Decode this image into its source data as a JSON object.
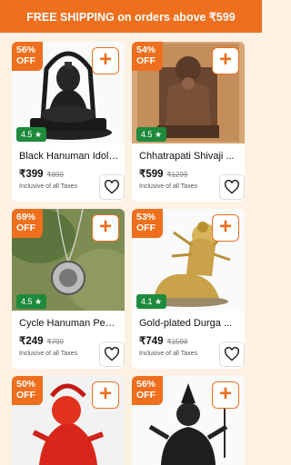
{
  "banner": {
    "text": "FREE SHIPPING on orders above ₹599"
  },
  "add_icon": "+",
  "products": [
    {
      "discount_pct": "56%",
      "discount_off": "OFF",
      "rating": "4.5 ★",
      "name": "Black Hanuman Idol ...",
      "price": "₹399",
      "mrp": "₹899",
      "tax": "Inclusive of all Taxes",
      "image": "black hanuman statue"
    },
    {
      "discount_pct": "54%",
      "discount_off": "OFF",
      "rating": "4.5 ★",
      "name": "Chhatrapati Shivaji ...",
      "price": "₹599",
      "mrp": "₹1299",
      "tax": "Inclusive of all Taxes",
      "image": "bronze shivaji statue"
    },
    {
      "discount_pct": "69%",
      "discount_off": "OFF",
      "rating": "4.5 ★",
      "name": "Cycle Hanuman Pen...",
      "price": "₹249",
      "mrp": "₹799",
      "tax": "Inclusive of all Taxes",
      "image": "silver hanuman pendant"
    },
    {
      "discount_pct": "53%",
      "discount_off": "OFF",
      "rating": "4.1 ★",
      "name": "Gold-plated Durga ...",
      "price": "₹749",
      "mrp": "₹1598",
      "tax": "Inclusive of all Taxes",
      "image": "gold durga statue"
    },
    {
      "discount_pct": "50%",
      "discount_off": "OFF",
      "image": "red hanuman statue"
    },
    {
      "discount_pct": "56%",
      "discount_off": "OFF",
      "image": "black shiva statue"
    }
  ]
}
